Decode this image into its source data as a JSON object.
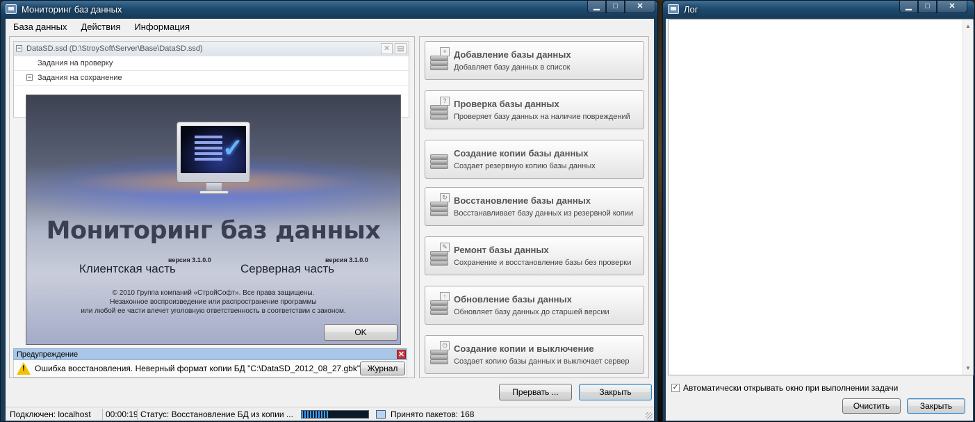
{
  "main_window": {
    "title": "Мониторинг баз данных",
    "controls": {
      "minimize": "▁",
      "maximize": "□",
      "close": "✕"
    }
  },
  "menu": [
    "База данных",
    "Действия",
    "Информация"
  ],
  "tree": {
    "header": "DataSD.ssd (D:\\StroySoft\\Server\\Base\\DataSD.ssd)",
    "expander": "−",
    "items": [
      "Задания на проверку",
      "Задания на сохранение"
    ]
  },
  "splash": {
    "title": "Мониторинг баз данных",
    "client_label": "Клиентская часть",
    "client_version": "версия 3.1.0.0",
    "server_label": "Серверная часть",
    "server_version": "версия 3.1.0.0",
    "copyright_1": "© 2010 Группа компаний «СтройСофт». Все права защищены.",
    "copyright_2": "Незаконное воспроизведение или распространение программы",
    "copyright_3": "или любой ее части влечет уголовную ответственность в соответствии с законом.",
    "ok_label": "OK"
  },
  "warning": {
    "header": "Предупреждение",
    "message": "Ошибка восстановления. Неверный формат копии БД \"C:\\DataSD_2012_08_27.gbk\"",
    "journal_label": "Журнал"
  },
  "actions": [
    {
      "title": "Добавление базы данных",
      "desc": "Добавляет базу данных в список",
      "badge": "+"
    },
    {
      "title": "Проверка базы данных",
      "desc": "Проверяет базу данных на наличие повреждений",
      "badge": "?"
    },
    {
      "title": "Создание копии базы данных",
      "desc": "Создает резервную копию базы данных",
      "badge": ""
    },
    {
      "title": "Восстановление базы данных",
      "desc": "Восстанавливает базу данных из резервной копии",
      "badge": "↻"
    },
    {
      "title": "Ремонт базы данных",
      "desc": "Сохранение и восстановление базы без проверки",
      "badge": "✎"
    },
    {
      "title": "Обновление базы данных",
      "desc": "Обновляет базу данных до старшей версии",
      "badge": "↑"
    },
    {
      "title": "Создание копии и выключение",
      "desc": "Создает копию базы данных и выключает сервер",
      "badge": "⏻"
    }
  ],
  "bottom_buttons": {
    "abort": "Прервать ...",
    "close": "Закрыть"
  },
  "status": {
    "connected": "Подключен: localhost",
    "elapsed": "00:00:19",
    "status": "Статус: Восстановление БД из копии ...",
    "progress": 0.42,
    "packets": "Принято пакетов: 168"
  },
  "log_window": {
    "title": "Лог",
    "auto_open_label": "Автоматически открывать окно при  выполнении задачи",
    "auto_open_checked": "✓",
    "clear_label": "Очистить",
    "close_label": "Закрыть"
  }
}
